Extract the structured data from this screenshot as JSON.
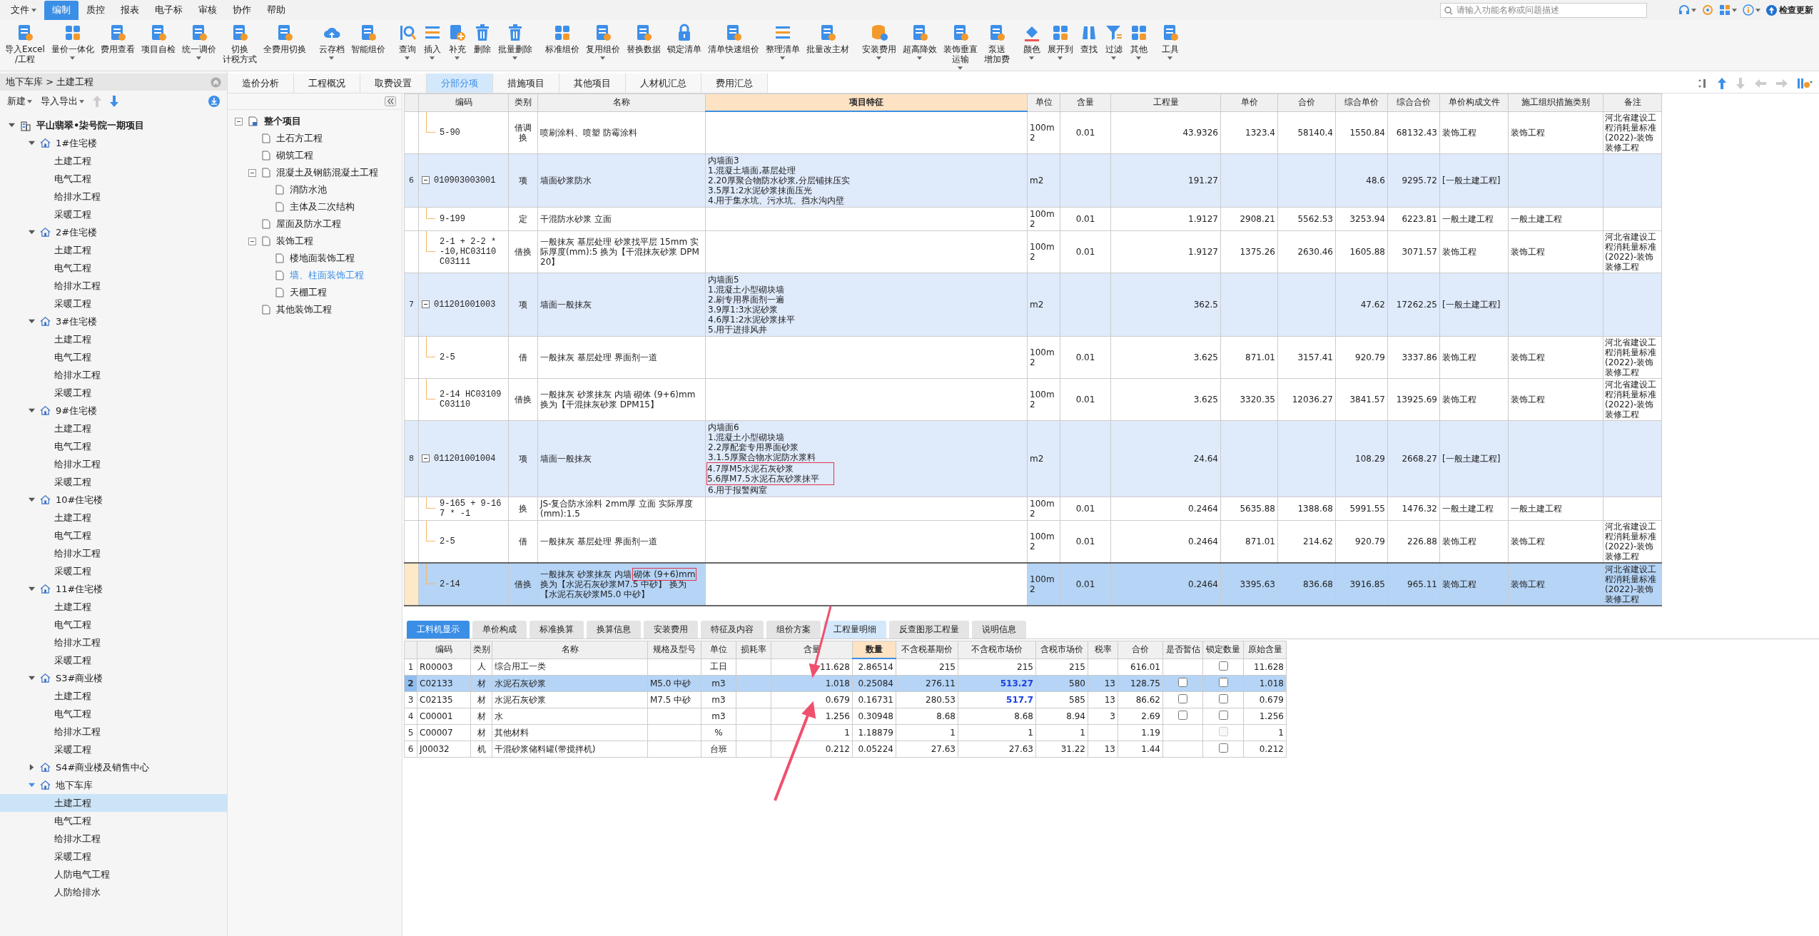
{
  "menu": {
    "items": [
      {
        "label": "文件",
        "has_menu": true,
        "selected": false
      },
      {
        "label": "编制",
        "has_menu": false,
        "selected": true
      },
      {
        "label": "质控",
        "has_menu": false,
        "selected": false
      },
      {
        "label": "报表",
        "has_menu": false,
        "selected": false
      },
      {
        "label": "电子标",
        "has_menu": false,
        "selected": false
      },
      {
        "label": "审核",
        "has_menu": false,
        "selected": false
      },
      {
        "label": "协作",
        "has_menu": false,
        "selected": false
      },
      {
        "label": "帮助",
        "has_menu": false,
        "selected": false
      }
    ],
    "search": {
      "placeholder": "请输入功能名称或问题描述"
    },
    "update_label": "检查更新"
  },
  "ribbon": [
    {
      "buttons": [
        {
          "lines": [
            "导入Excel",
            "/工程"
          ],
          "has_menu": false
        },
        {
          "lines": [
            "量价一体化"
          ],
          "has_menu": true
        },
        {
          "lines": [
            "费用查看"
          ],
          "has_menu": false
        },
        {
          "lines": [
            "项目自检"
          ],
          "has_menu": false
        },
        {
          "lines": [
            "统一调价"
          ],
          "has_menu": true
        },
        {
          "lines": [
            "切换",
            "计税方式"
          ],
          "has_menu": false
        },
        {
          "lines": [
            "全费用切换"
          ],
          "has_menu": false
        }
      ]
    },
    {
      "buttons": [
        {
          "lines": [
            "云存档"
          ],
          "has_menu": true
        },
        {
          "lines": [
            "智能组价"
          ],
          "has_menu": false
        }
      ]
    },
    {
      "buttons": [
        {
          "lines": [
            "查询"
          ],
          "has_menu": true
        },
        {
          "lines": [
            "插入"
          ],
          "has_menu": true
        },
        {
          "lines": [
            "补充"
          ],
          "has_menu": true
        },
        {
          "lines": [
            "删除"
          ],
          "has_menu": false
        },
        {
          "lines": [
            "批量删除"
          ],
          "has_menu": true
        }
      ]
    },
    {
      "buttons": [
        {
          "lines": [
            "标准组价"
          ],
          "has_menu": false
        },
        {
          "lines": [
            "复用组价"
          ],
          "has_menu": true
        },
        {
          "lines": [
            "替换数据"
          ],
          "has_menu": false
        },
        {
          "lines": [
            "锁定清单"
          ],
          "has_menu": false
        },
        {
          "lines": [
            "清单快速组价"
          ],
          "has_menu": false
        },
        {
          "lines": [
            "整理清单"
          ],
          "has_menu": true
        },
        {
          "lines": [
            "批量改主材"
          ],
          "has_menu": false
        }
      ]
    },
    {
      "buttons": [
        {
          "lines": [
            "安装费用"
          ],
          "has_menu": true
        },
        {
          "lines": [
            "超高降效"
          ],
          "has_menu": true
        },
        {
          "lines": [
            "装饰垂直",
            "运输"
          ],
          "has_menu": true
        },
        {
          "lines": [
            "泵送",
            "增加费"
          ],
          "has_menu": false
        }
      ]
    },
    {
      "buttons": [
        {
          "lines": [
            "颜色"
          ],
          "has_menu": true
        },
        {
          "lines": [
            "展开到"
          ],
          "has_menu": true
        },
        {
          "lines": [
            "查找"
          ],
          "has_menu": false
        },
        {
          "lines": [
            "过滤"
          ],
          "has_menu": true
        },
        {
          "lines": [
            "其他"
          ],
          "has_menu": true
        }
      ]
    },
    {
      "buttons": [
        {
          "lines": [
            "工具"
          ],
          "has_menu": true
        }
      ]
    }
  ],
  "left_panel": {
    "breadcrumb": "地下车库 > 土建工程",
    "new_label": "新建",
    "import_export_label": "导入导出",
    "tree": [
      {
        "kind": "project",
        "label": "平山翡翠•柒号院一期项目",
        "expanded": true,
        "selected": false,
        "children": [
          {
            "kind": "building",
            "label": "1#住宅楼",
            "expanded": true,
            "selected": false,
            "children": [
              {
                "kind": "unit",
                "label": "土建工程",
                "selected": false
              },
              {
                "kind": "unit",
                "label": "电气工程",
                "selected": false
              },
              {
                "kind": "unit",
                "label": "给排水工程",
                "selected": false
              },
              {
                "kind": "unit",
                "label": "采暖工程",
                "selected": false
              }
            ]
          },
          {
            "kind": "building",
            "label": "2#住宅楼",
            "expanded": true,
            "selected": false,
            "children": [
              {
                "kind": "unit",
                "label": "土建工程",
                "selected": false
              },
              {
                "kind": "unit",
                "label": "电气工程",
                "selected": false
              },
              {
                "kind": "unit",
                "label": "给排水工程",
                "selected": false
              },
              {
                "kind": "unit",
                "label": "采暖工程",
                "selected": false
              }
            ]
          },
          {
            "kind": "building",
            "label": "3#住宅楼",
            "expanded": true,
            "selected": false,
            "children": [
              {
                "kind": "unit",
                "label": "土建工程",
                "selected": false
              },
              {
                "kind": "unit",
                "label": "电气工程",
                "selected": false
              },
              {
                "kind": "unit",
                "label": "给排水工程",
                "selected": false
              },
              {
                "kind": "unit",
                "label": "采暖工程",
                "selected": false
              }
            ]
          },
          {
            "kind": "building",
            "label": "9#住宅楼",
            "expanded": true,
            "selected": false,
            "children": [
              {
                "kind": "unit",
                "label": "土建工程",
                "selected": false
              },
              {
                "kind": "unit",
                "label": "电气工程",
                "selected": false
              },
              {
                "kind": "unit",
                "label": "给排水工程",
                "selected": false
              },
              {
                "kind": "unit",
                "label": "采暖工程",
                "selected": false
              }
            ]
          },
          {
            "kind": "building",
            "label": "10#住宅楼",
            "expanded": true,
            "selected": false,
            "children": [
              {
                "kind": "unit",
                "label": "土建工程",
                "selected": false
              },
              {
                "kind": "unit",
                "label": "电气工程",
                "selected": false
              },
              {
                "kind": "unit",
                "label": "给排水工程",
                "selected": false
              },
              {
                "kind": "unit",
                "label": "采暖工程",
                "selected": false
              }
            ]
          },
          {
            "kind": "building",
            "label": "11#住宅楼",
            "expanded": true,
            "selected": false,
            "children": [
              {
                "kind": "unit",
                "label": "土建工程",
                "selected": false
              },
              {
                "kind": "unit",
                "label": "电气工程",
                "selected": false
              },
              {
                "kind": "unit",
                "label": "给排水工程",
                "selected": false
              },
              {
                "kind": "unit",
                "label": "采暖工程",
                "selected": false
              }
            ]
          },
          {
            "kind": "building",
            "label": "S3#商业楼",
            "expanded": true,
            "selected": false,
            "children": [
              {
                "kind": "unit",
                "label": "土建工程",
                "selected": false
              },
              {
                "kind": "unit",
                "label": "电气工程",
                "selected": false
              },
              {
                "kind": "unit",
                "label": "给排水工程",
                "selected": false
              },
              {
                "kind": "unit",
                "label": "采暖工程",
                "selected": false
              }
            ]
          },
          {
            "kind": "building",
            "label": "S4#商业楼及销售中心",
            "expanded": false,
            "selected": false
          },
          {
            "kind": "building",
            "label": "地下车库",
            "expanded": true,
            "selected": false,
            "children": [
              {
                "kind": "unit",
                "label": "土建工程",
                "selected": true
              },
              {
                "kind": "unit",
                "label": "电气工程",
                "selected": false
              },
              {
                "kind": "unit",
                "label": "给排水工程",
                "selected": false
              },
              {
                "kind": "unit",
                "label": "采暖工程",
                "selected": false
              },
              {
                "kind": "unit",
                "label": "人防电气工程",
                "selected": false
              },
              {
                "kind": "unit",
                "label": "人防给排水",
                "selected": false
              }
            ]
          }
        ]
      }
    ]
  },
  "tabs": [
    {
      "label": "造价分析",
      "selected": false
    },
    {
      "label": "工程概况",
      "selected": false
    },
    {
      "label": "取费设置",
      "selected": false
    },
    {
      "label": "分部分项",
      "selected": true
    },
    {
      "label": "措施项目",
      "selected": false
    },
    {
      "label": "其他项目",
      "selected": false
    },
    {
      "label": "人材机汇总",
      "selected": false
    },
    {
      "label": "费用汇总",
      "selected": false
    }
  ],
  "section_tree": [
    {
      "kind": "project",
      "label": "整个项目",
      "expanded": true,
      "selected": false,
      "children": [
        {
          "kind": "section",
          "label": "土石方工程",
          "selected": false
        },
        {
          "kind": "section",
          "label": "砌筑工程",
          "selected": false
        },
        {
          "kind": "section",
          "label": "混凝土及钢筋混凝土工程",
          "expanded": true,
          "selected": false,
          "children": [
            {
              "kind": "section",
              "label": "消防水池",
              "selected": false
            },
            {
              "kind": "section",
              "label": "主体及二次结构",
              "selected": false
            }
          ]
        },
        {
          "kind": "section",
          "label": "屋面及防水工程",
          "selected": false
        },
        {
          "kind": "section",
          "label": "装饰工程",
          "expanded": true,
          "selected": false,
          "children": [
            {
              "kind": "section",
              "label": "楼地面装饰工程",
              "selected": false
            },
            {
              "kind": "section",
              "label": "墙、柱面装饰工程",
              "selected": true
            },
            {
              "kind": "section",
              "label": "天棚工程",
              "selected": false
            }
          ]
        },
        {
          "kind": "section",
          "label": "其他装饰工程",
          "selected": false
        }
      ]
    }
  ],
  "table": {
    "columns": [
      {
        "label": "编码",
        "active": false
      },
      {
        "label": "类别",
        "active": false
      },
      {
        "label": "名称",
        "active": false
      },
      {
        "label": "项目特征",
        "active": true
      },
      {
        "label": "单位",
        "active": false
      },
      {
        "label": "含量",
        "active": false
      },
      {
        "label": "工程量",
        "active": false
      },
      {
        "label": "单价",
        "active": false
      },
      {
        "label": "合价",
        "active": false
      },
      {
        "label": "综合单价",
        "active": false
      },
      {
        "label": "综合合价",
        "active": false
      },
      {
        "label": "单价构成文件",
        "active": false
      },
      {
        "label": "施工组织措施类别",
        "active": false
      },
      {
        "label": "备注",
        "active": false
      }
    ],
    "rows": [
      {
        "kind": "sub",
        "selected": false,
        "code": "5-90",
        "type": "借调换",
        "name": "喷刷涂料、喷塑 防霉涂料",
        "unit": "100m2",
        "ratio": "0.01",
        "quantity": "43.9326",
        "unit_price": "1323.4",
        "total": "58140.4",
        "comp_unit_price": "1550.84",
        "comp_total": "68132.43",
        "price_file": "装饰工程",
        "measure_category": "装饰工程",
        "note": "河北省建设工程消耗量标准(2022)-装饰装修工程"
      },
      {
        "kind": "item",
        "no": "6",
        "expanded": true,
        "selected": false,
        "code": "010903003001",
        "type": "项",
        "name": "墙面砂浆防水",
        "feature": [
          {
            "text": "内墙面3",
            "annotated": false
          },
          {
            "text": "1.混凝土墙面,基层处理",
            "annotated": false
          },
          {
            "text": "2.20厚聚合物防水砂浆,分层铺抹压实",
            "annotated": false
          },
          {
            "text": "3.5厚1:2水泥砂浆抹面压光",
            "annotated": false
          },
          {
            "text": "4.用于集水坑、污水坑、挡水沟内壁",
            "annotated": false
          }
        ],
        "unit": "m2",
        "quantity": "191.27",
        "comp_unit_price": "48.6",
        "comp_total": "9295.72",
        "price_file": "[一般土建工程]"
      },
      {
        "kind": "sub",
        "selected": false,
        "code": "9-199",
        "type": "定",
        "name": "干混防水砂浆 立面",
        "unit": "100m2",
        "ratio": "0.01",
        "quantity": "1.9127",
        "unit_price": "2908.21",
        "total": "5562.53",
        "comp_unit_price": "3253.94",
        "comp_total": "6223.81",
        "price_file": "一般土建工程",
        "measure_category": "一般土建工程"
      },
      {
        "kind": "sub",
        "selected": false,
        "code": "2-1 + 2-2 * -10,HC03110 C03111",
        "type": "借换",
        "name": "一般抹灰 基层处理 砂浆找平层 15mm 实际厚度(mm):5 换为【干混抹灰砂浆 DPM20】",
        "unit": "100m2",
        "ratio": "0.01",
        "quantity": "1.9127",
        "unit_price": "1375.26",
        "total": "2630.46",
        "comp_unit_price": "1605.88",
        "comp_total": "3071.57",
        "price_file": "装饰工程",
        "measure_category": "装饰工程",
        "note": "河北省建设工程消耗量标准(2022)-装饰装修工程"
      },
      {
        "kind": "item",
        "no": "7",
        "expanded": true,
        "selected": false,
        "code": "011201001003",
        "type": "项",
        "name": "墙面一般抹灰",
        "feature": [
          {
            "text": "内墙面5",
            "annotated": false
          },
          {
            "text": "1.混凝土小型砌块墙",
            "annotated": false
          },
          {
            "text": "2.刷专用界面剂一遍",
            "annotated": false
          },
          {
            "text": "3.9厚1:3水泥砂浆",
            "annotated": false
          },
          {
            "text": "4.6厚1:2水泥砂浆抹平",
            "annotated": false
          },
          {
            "text": "5.用于进排风井",
            "annotated": false
          }
        ],
        "unit": "m2",
        "quantity": "362.5",
        "comp_unit_price": "47.62",
        "comp_total": "17262.25",
        "price_file": "[一般土建工程]"
      },
      {
        "kind": "sub",
        "selected": false,
        "code": "2-5",
        "type": "借",
        "name": "一般抹灰 基层处理 界面剂一道",
        "unit": "100m2",
        "ratio": "0.01",
        "quantity": "3.625",
        "unit_price": "871.01",
        "total": "3157.41",
        "comp_unit_price": "920.79",
        "comp_total": "3337.86",
        "price_file": "装饰工程",
        "measure_category": "装饰工程",
        "note": "河北省建设工程消耗量标准(2022)-装饰装修工程"
      },
      {
        "kind": "sub",
        "selected": false,
        "code": "2-14 HC03109 C03110",
        "type": "借换",
        "name": "一般抹灰 砂浆抹灰 内墙 砌体 (9+6)mm 换为【干混抹灰砂浆 DPM15】",
        "unit": "100m2",
        "ratio": "0.01",
        "quantity": "3.625",
        "unit_price": "3320.35",
        "total": "12036.27",
        "comp_unit_price": "3841.57",
        "comp_total": "13925.69",
        "price_file": "装饰工程",
        "measure_category": "装饰工程",
        "note": "河北省建设工程消耗量标准(2022)-装饰装修工程"
      },
      {
        "kind": "item",
        "no": "8",
        "expanded": true,
        "selected": false,
        "code": "011201001004",
        "type": "项",
        "name": "墙面一般抹灰",
        "feature": [
          {
            "text": "内墙面6",
            "annotated": false
          },
          {
            "text": "1.混凝土小型砌块墙",
            "annotated": false
          },
          {
            "text": "2.2厚配套专用界面砂浆",
            "annotated": false
          },
          {
            "text": "3.1.5厚聚合物水泥防水浆料",
            "annotated": false
          },
          {
            "text": "4.7厚M5水泥石灰砂浆",
            "annotated": true
          },
          {
            "text": "5.6厚M7.5水泥石灰砂浆抹平",
            "annotated": true
          },
          {
            "text": "6.用于报警阀室",
            "annotated": false
          }
        ],
        "unit": "m2",
        "quantity": "24.64",
        "comp_unit_price": "108.29",
        "comp_total": "2668.27",
        "price_file": "[一般土建工程]"
      },
      {
        "kind": "sub",
        "selected": false,
        "code": "9-165 + 9-167 * -1",
        "type": "换",
        "name": "JS-复合防水涂料 2mm厚 立面 实际厚度(mm):1.5",
        "unit": "100m2",
        "ratio": "0.01",
        "quantity": "0.2464",
        "unit_price": "5635.88",
        "total": "1388.68",
        "comp_unit_price": "5991.55",
        "comp_total": "1476.32",
        "price_file": "一般土建工程",
        "measure_category": "一般土建工程"
      },
      {
        "kind": "sub",
        "selected": false,
        "code": "2-5",
        "type": "借",
        "name": "一般抹灰 基层处理 界面剂一道",
        "unit": "100m2",
        "ratio": "0.01",
        "quantity": "0.2464",
        "unit_price": "871.01",
        "total": "214.62",
        "comp_unit_price": "920.79",
        "comp_total": "226.88",
        "price_file": "装饰工程",
        "measure_category": "装饰工程",
        "note": "河北省建设工程消耗量标准(2022)-装饰装修工程"
      },
      {
        "kind": "sub",
        "selected": true,
        "code": "2-14",
        "type": "借换",
        "name_parts": [
          {
            "text": "一般抹灰 砂浆抹灰 内墙 ",
            "annotated": false
          },
          {
            "text": "砌体 (9+6)mm",
            "annotated": true
          },
          {
            "text": " 换为【水泥石灰砂浆M7.5 中砂】 换为【水泥石灰砂浆M5.0 中砂】",
            "annotated": false
          }
        ],
        "unit": "100m2",
        "ratio": "0.01",
        "quantity": "0.2464",
        "unit_price": "3395.63",
        "total": "836.68",
        "comp_unit_price": "3916.85",
        "comp_total": "965.11",
        "price_file": "装饰工程",
        "measure_category": "装饰工程",
        "note": "河北省建设工程消耗量标准(2022)-装饰装修工程"
      }
    ]
  },
  "detail_tabs": [
    {
      "label": "工料机显示",
      "selected": true,
      "hovered": false
    },
    {
      "label": "单价构成",
      "selected": false,
      "hovered": false
    },
    {
      "label": "标准换算",
      "selected": false,
      "hovered": false
    },
    {
      "label": "换算信息",
      "selected": false,
      "hovered": false
    },
    {
      "label": "安装费用",
      "selected": false,
      "hovered": false
    },
    {
      "label": "特征及内容",
      "selected": false,
      "hovered": false
    },
    {
      "label": "组价方案",
      "selected": false,
      "hovered": false
    },
    {
      "label": "工程量明细",
      "selected": false,
      "hovered": true
    },
    {
      "label": "反查图形工程量",
      "selected": false,
      "hovered": false
    },
    {
      "label": "说明信息",
      "selected": false,
      "hovered": false
    }
  ],
  "detail_table": {
    "columns": [
      {
        "label": "编码",
        "active": false
      },
      {
        "label": "类别",
        "active": false
      },
      {
        "label": "名称",
        "active": false
      },
      {
        "label": "规格及型号",
        "active": false
      },
      {
        "label": "单位",
        "active": false
      },
      {
        "label": "损耗率",
        "active": false
      },
      {
        "label": "含量",
        "active": false
      },
      {
        "label": "数量",
        "active": true
      },
      {
        "label": "不含税基期价",
        "active": false
      },
      {
        "label": "不含税市场价",
        "active": false
      },
      {
        "label": "含税市场价",
        "active": false
      },
      {
        "label": "税率",
        "active": false
      },
      {
        "label": "合价",
        "active": false
      },
      {
        "label": "是否暂估",
        "active": false
      },
      {
        "label": "锁定数量",
        "active": false
      },
      {
        "label": "原始含量",
        "active": false
      }
    ],
    "rows": [
      {
        "no": "1",
        "selected": false,
        "code": "R00003",
        "type": "人",
        "name": "综合用工一类",
        "unit": "工日",
        "ratio": "11.628",
        "quantity": "2.86514",
        "base_price": "215",
        "market_price": "215",
        "price_modified": false,
        "tax_price": "215",
        "total": "616.01",
        "locked_checked": false,
        "locked_disabled": false,
        "original_ratio": "11.628"
      },
      {
        "no": "2",
        "selected": true,
        "code": "C02133",
        "type": "材",
        "name": "水泥石灰砂浆",
        "spec": "M5.0 中砂",
        "unit": "m3",
        "ratio": "1.018",
        "quantity": "0.25084",
        "base_price": "276.11",
        "market_price": "513.27",
        "price_modified": true,
        "tax_price": "580",
        "tax_rate": "13",
        "total": "128.75",
        "provisional_checked": false,
        "locked_checked": false,
        "locked_disabled": false,
        "original_ratio": "1.018"
      },
      {
        "no": "3",
        "selected": false,
        "code": "C02135",
        "type": "材",
        "name": "水泥石灰砂浆",
        "spec": "M7.5 中砂",
        "unit": "m3",
        "ratio": "0.679",
        "quantity": "0.16731",
        "base_price": "280.53",
        "market_price": "517.7",
        "price_modified": true,
        "tax_price": "585",
        "tax_rate": "13",
        "total": "86.62",
        "provisional_checked": false,
        "locked_checked": false,
        "locked_disabled": false,
        "original_ratio": "0.679"
      },
      {
        "no": "4",
        "selected": false,
        "code": "C00001",
        "type": "材",
        "name": "水",
        "unit": "m3",
        "ratio": "1.256",
        "quantity": "0.30948",
        "base_price": "8.68",
        "market_price": "8.68",
        "price_modified": false,
        "tax_price": "8.94",
        "tax_rate": "3",
        "total": "2.69",
        "provisional_checked": false,
        "locked_checked": false,
        "locked_disabled": false,
        "original_ratio": "1.256"
      },
      {
        "no": "5",
        "selected": false,
        "code": "C00007",
        "type": "材",
        "name": "其他材料",
        "unit": "%",
        "ratio": "1",
        "quantity": "1.18879",
        "base_price": "1",
        "market_price": "1",
        "price_modified": false,
        "tax_price": "1",
        "total": "1.19",
        "locked_checked": false,
        "locked_disabled": true,
        "original_ratio": "1"
      },
      {
        "no": "6",
        "selected": false,
        "code": "J00032",
        "type": "机",
        "name": "干混砂浆储料罐(带搅拌机)",
        "unit": "台班",
        "ratio": "0.212",
        "quantity": "0.05224",
        "base_price": "27.63",
        "market_price": "27.63",
        "price_modified": false,
        "tax_price": "31.22",
        "tax_rate": "13",
        "total": "1.44",
        "locked_checked": false,
        "locked_disabled": false,
        "original_ratio": "0.212"
      }
    ]
  }
}
